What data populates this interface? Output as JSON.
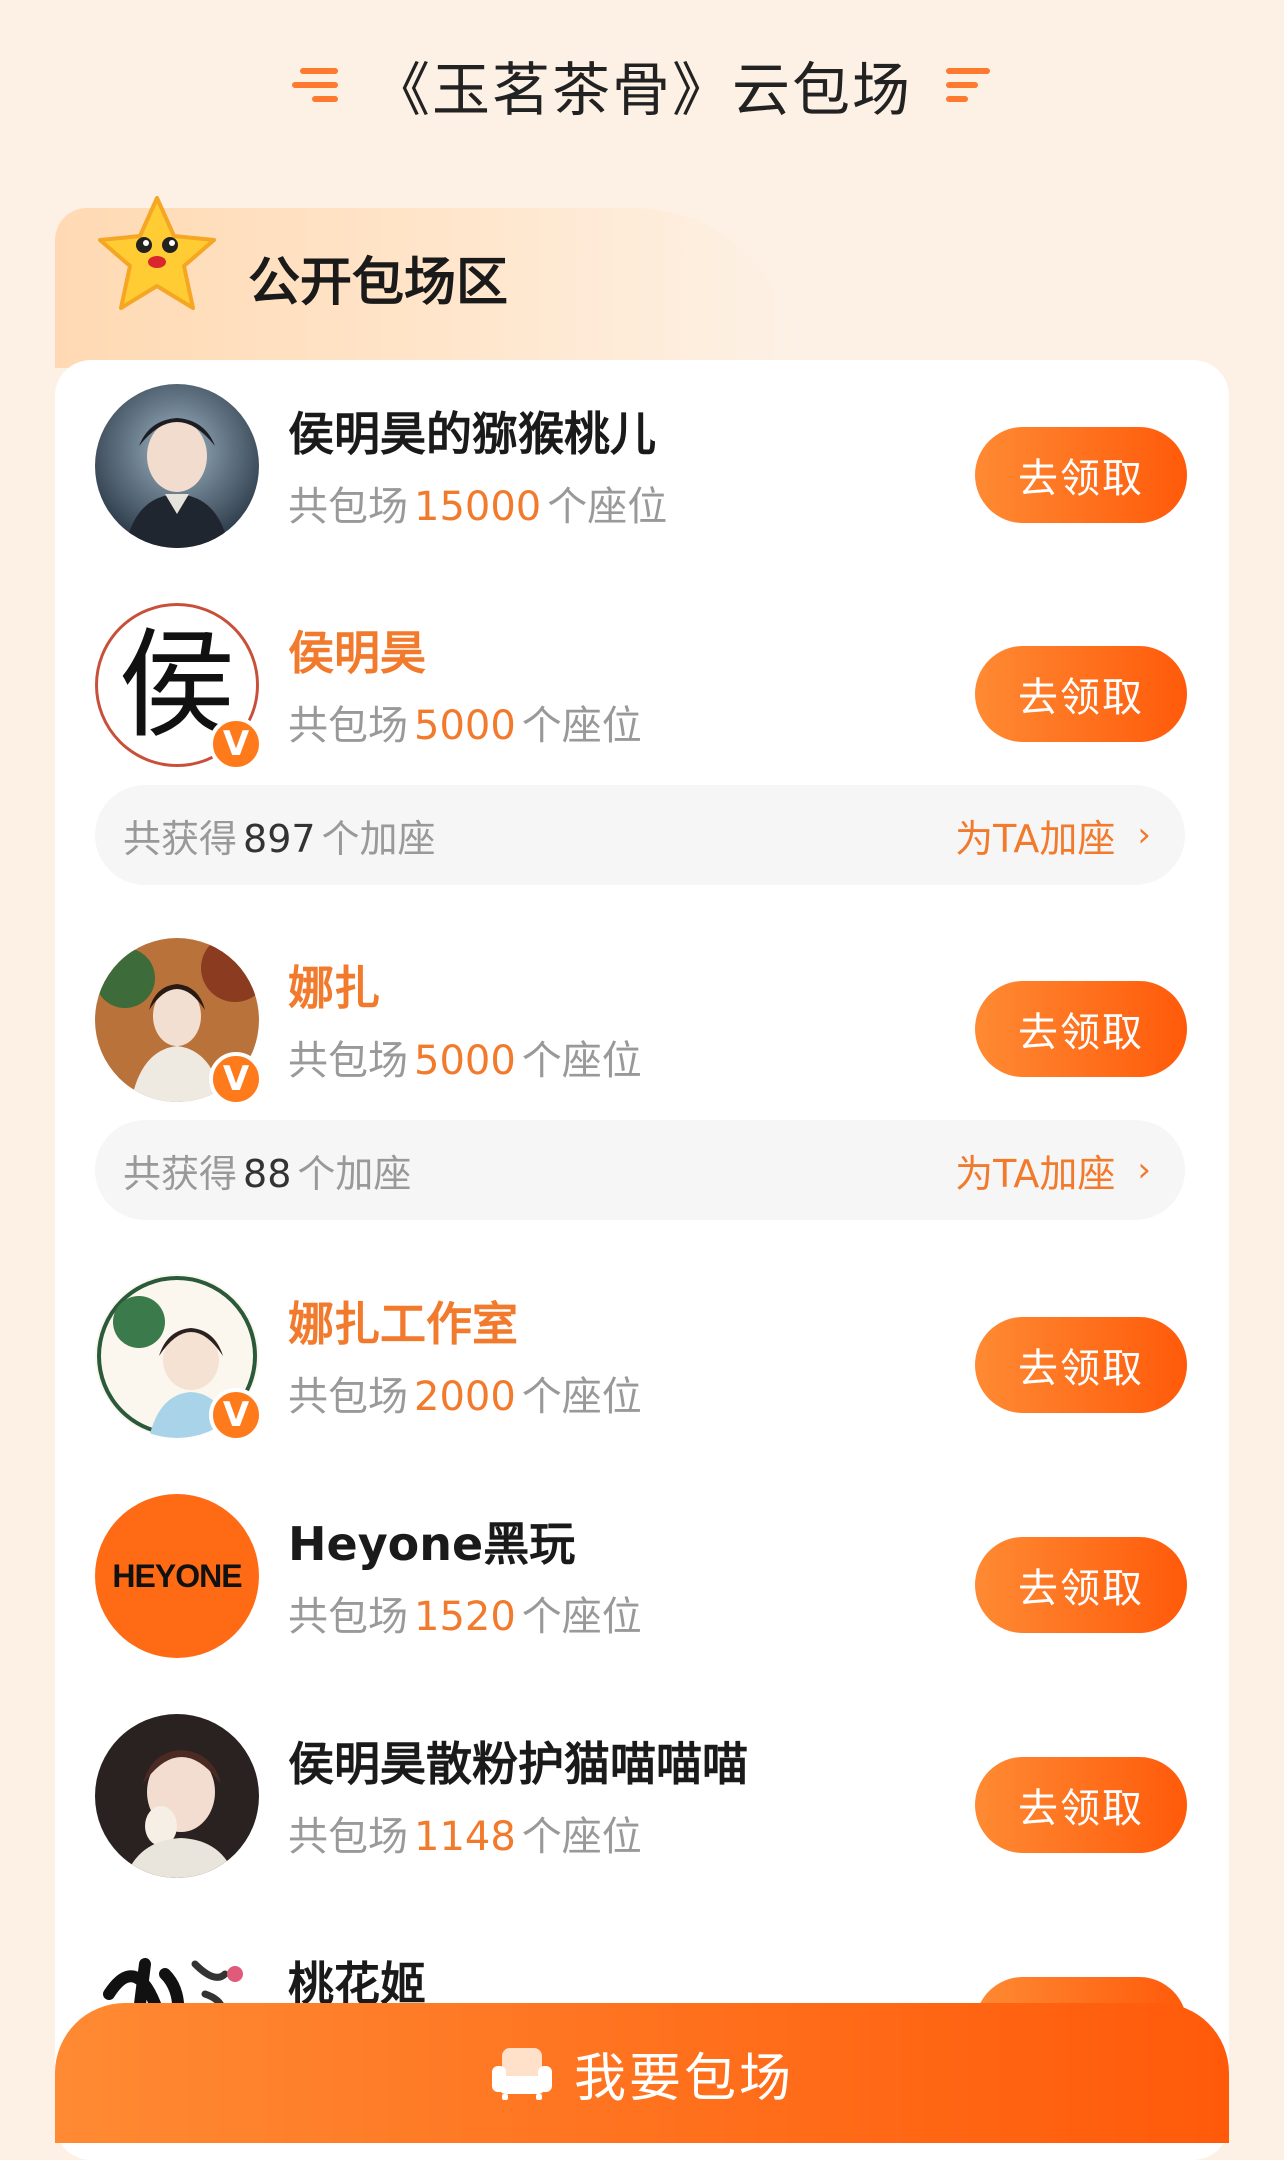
{
  "header": {
    "title": "《玉茗茶骨》云包场"
  },
  "section": {
    "title": "公开包场区"
  },
  "rows": [
    {
      "name": "侯明昊的猕猴桃儿",
      "seats_prefix": "共包场",
      "seats": "15000",
      "seats_suffix": "个座位",
      "button": "去领取"
    },
    {
      "name": "侯明昊",
      "seats_prefix": "共包场",
      "seats": "5000",
      "seats_suffix": "个座位",
      "button": "去领取",
      "avatar_text": "侯",
      "extra": {
        "prefix": "共获得",
        "count": "897",
        "suffix": "个加座",
        "link": "为TA加座"
      }
    },
    {
      "name": "娜扎",
      "seats_prefix": "共包场",
      "seats": "5000",
      "seats_suffix": "个座位",
      "button": "去领取",
      "extra": {
        "prefix": "共获得",
        "count": "88",
        "suffix": "个加座",
        "link": "为TA加座"
      }
    },
    {
      "name": "娜扎工作室",
      "seats_prefix": "共包场",
      "seats": "2000",
      "seats_suffix": "个座位",
      "button": "去领取"
    },
    {
      "name": "Heyone黑玩",
      "seats_prefix": "共包场",
      "seats": "1520",
      "seats_suffix": "个座位",
      "button": "去领取",
      "avatar_text": "HEYONE"
    },
    {
      "name": "侯明昊散粉护猫喵喵喵",
      "seats_prefix": "共包场",
      "seats": "1148",
      "seats_suffix": "个座位",
      "button": "去领取"
    },
    {
      "name": "桃花姬"
    }
  ],
  "verified_badge": "V",
  "bottom": {
    "label": "我要包场"
  },
  "colors": {
    "accent": "#ff6a14",
    "background": "#fdf1e5"
  }
}
